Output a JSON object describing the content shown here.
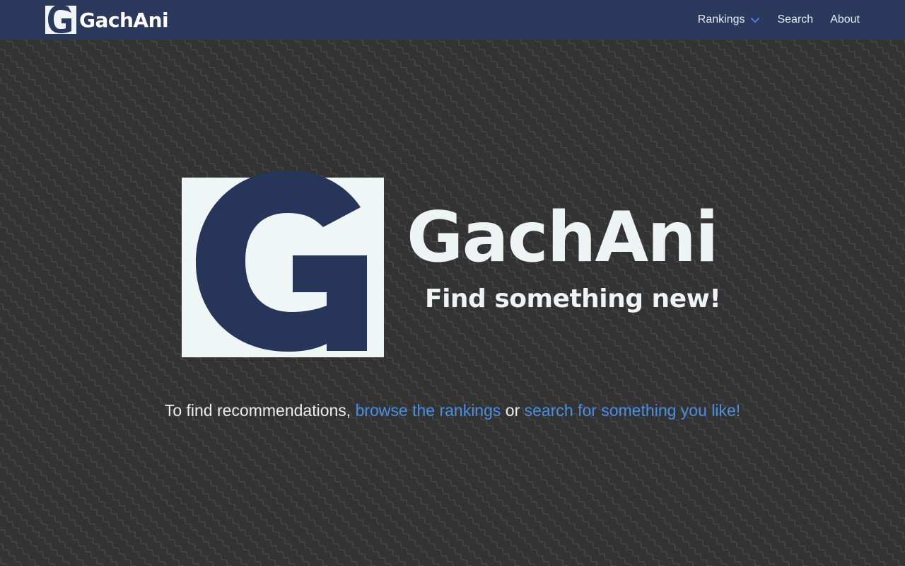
{
  "brand": {
    "name": "GachAni",
    "logo_icon": "g-logo-icon"
  },
  "nav": {
    "rankings_label": "Rankings",
    "search_label": "Search",
    "about_label": "About"
  },
  "hero": {
    "logo_icon": "g-logo-icon",
    "title": "GachAni",
    "tagline": "Find something new!"
  },
  "cta": {
    "prefix": "To find recommendations, ",
    "rankings_link": "browse the rankings",
    "middle": " or ",
    "search_link": "search for something you like!"
  },
  "colors": {
    "navbar_bg": "#2b3a5c",
    "page_bg": "#333333",
    "logo_blue": "#27355a",
    "logo_white": "#f0f5f5",
    "link_blue": "#4a8fe0",
    "chevron_blue": "#4a7be6"
  }
}
